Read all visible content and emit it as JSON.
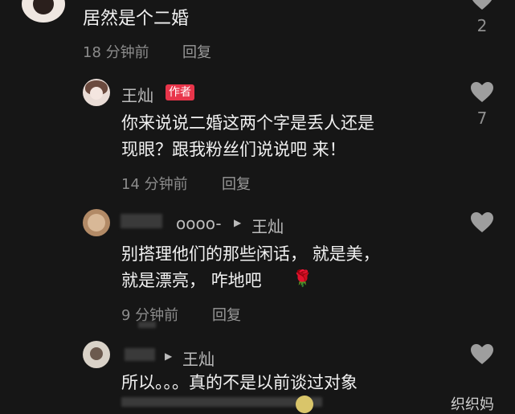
{
  "comments": [
    {
      "text": "居然是个二婚",
      "time": "18 分钟前",
      "reply": "回复",
      "likes": "2"
    },
    {
      "author": "王灿",
      "badge": "作者",
      "lines": [
        "你来说说二婚这两个字是丢人还是",
        "现眼？跟我粉丝们说说吧 来！"
      ],
      "time": "14 分钟前",
      "reply": "回复",
      "likes": "7"
    },
    {
      "author": "oooo-",
      "reply_to": "王灿",
      "lines": [
        "别搭理他们的那些闲话， 就是美，",
        "就是漂亮， 咋地吧"
      ],
      "emoji": "🌹",
      "time": "9 分钟前",
      "reply": "回复"
    },
    {
      "author": "",
      "reply_to": "王灿",
      "lines": [
        "所以。。。真的不是以前谈过对象"
      ],
      "partial_right": "织织妈"
    }
  ],
  "icons": {
    "like": "heart-outline-icon",
    "arrow": "reply-arrow-icon",
    "colors": {
      "heart": "#9e9e9e",
      "badge": "#e8354a"
    }
  }
}
